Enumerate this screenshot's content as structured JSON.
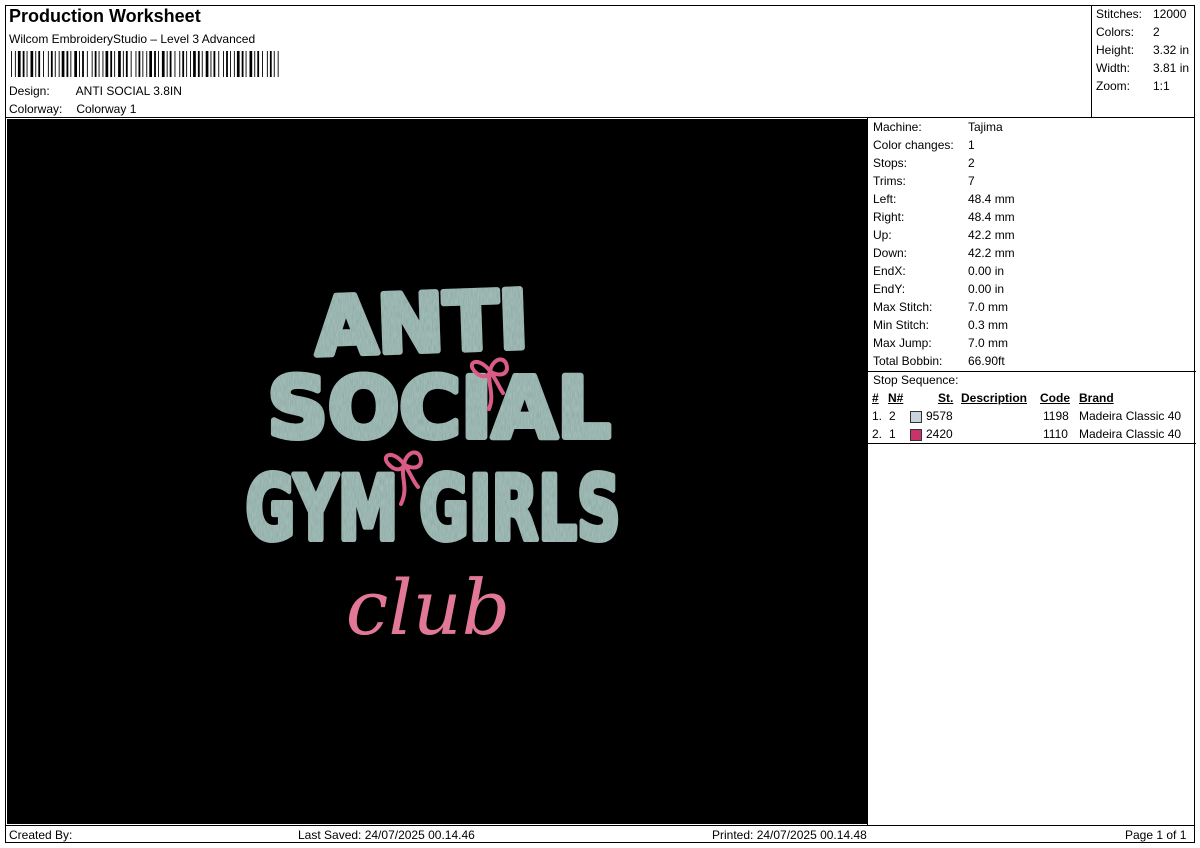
{
  "header": {
    "title": "Production Worksheet",
    "software": "Wilcom EmbroideryStudio – Level 3 Advanced",
    "design_label": "Design:",
    "design_value": "ANTI SOCIAL 3.8IN",
    "colorway_label": "Colorway:",
    "colorway_value": "Colorway 1"
  },
  "summary": [
    {
      "label": "Stitches:",
      "value": "12000"
    },
    {
      "label": "Colors:",
      "value": "2"
    },
    {
      "label": "Height:",
      "value": "3.32 in"
    },
    {
      "label": "Width:",
      "value": "3.81 in"
    },
    {
      "label": "Zoom:",
      "value": "1:1"
    }
  ],
  "properties": [
    {
      "label": "Machine:",
      "value": "Tajima"
    },
    {
      "label": "Color changes:",
      "value": "1"
    },
    {
      "label": "Stops:",
      "value": "2"
    },
    {
      "label": "Trims:",
      "value": "7"
    },
    {
      "label": "Left:",
      "value": "48.4 mm"
    },
    {
      "label": "Right:",
      "value": "48.4 mm"
    },
    {
      "label": "Up:",
      "value": "42.2 mm"
    },
    {
      "label": "Down:",
      "value": "42.2 mm"
    },
    {
      "label": "EndX:",
      "value": "0.00 in"
    },
    {
      "label": "EndY:",
      "value": "0.00 in"
    },
    {
      "label": "Max Stitch:",
      "value": "7.0 mm"
    },
    {
      "label": "Min Stitch:",
      "value": "0.3 mm"
    },
    {
      "label": "Max Jump:",
      "value": "7.0 mm"
    },
    {
      "label": "Total Bobbin:",
      "value": "66.90ft"
    }
  ],
  "stop_sequence": {
    "title": "Stop Sequence:",
    "headers": {
      "hash": "#",
      "n": "N#",
      "st": "St.",
      "description": "Description",
      "code": "Code",
      "brand": "Brand"
    },
    "rows": [
      {
        "index": "1.",
        "n": "2",
        "color": "#c9d3de",
        "st": "9578",
        "description": "",
        "code": "1198",
        "brand": "Madeira Classic 40"
      },
      {
        "index": "2.",
        "n": "1",
        "color": "#c8336a",
        "st": "2420",
        "description": "",
        "code": "1110",
        "brand": "Madeira Classic 40"
      }
    ]
  },
  "design_preview": {
    "lines": [
      "ANTI",
      "SOCIAL",
      "GYM GIRLS"
    ],
    "script_word": "club",
    "thread_colors": {
      "main": "#a9c6c0",
      "accent": "#e07896"
    }
  },
  "footer": {
    "created_by": "Created By:",
    "last_saved": "Last Saved: 24/07/2025 00.14.46",
    "printed": "Printed: 24/07/2025 00.14.48",
    "page": "Page 1 of 1"
  }
}
